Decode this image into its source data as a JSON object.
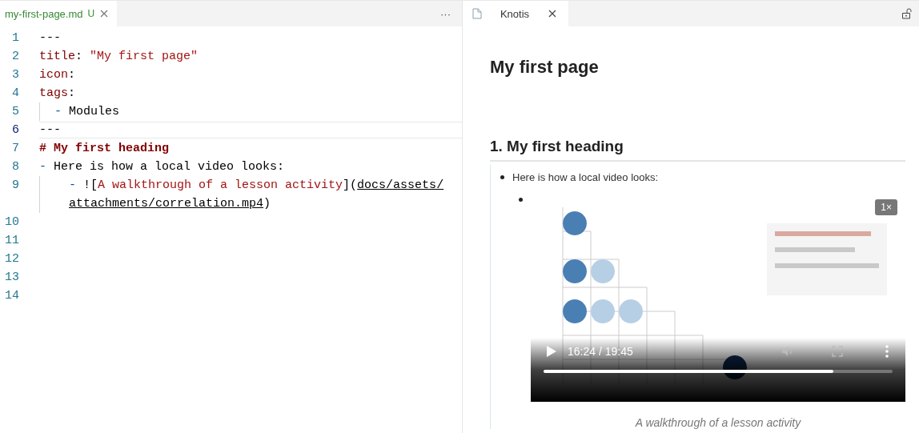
{
  "editor": {
    "tab": {
      "filename": "my-first-page.md",
      "status": "U",
      "selected": true
    },
    "more": "···",
    "lines": [
      {
        "number": "1",
        "current": false,
        "guide": false,
        "segments": [
          {
            "kind": "punct",
            "text": "---"
          }
        ]
      },
      {
        "number": "2",
        "current": false,
        "guide": false,
        "segments": [
          {
            "kind": "key",
            "text": "title"
          },
          {
            "kind": "punct",
            "text": ": "
          },
          {
            "kind": "string",
            "text": "\"My first page\""
          }
        ]
      },
      {
        "number": "3",
        "current": false,
        "guide": false,
        "segments": [
          {
            "kind": "key",
            "text": "icon"
          },
          {
            "kind": "punct",
            "text": ":"
          }
        ]
      },
      {
        "number": "4",
        "current": false,
        "guide": false,
        "segments": [
          {
            "kind": "key",
            "text": "tags"
          },
          {
            "kind": "punct",
            "text": ":"
          }
        ]
      },
      {
        "number": "5",
        "current": false,
        "guide": true,
        "segments": [
          {
            "kind": "bullet",
            "text": "  - "
          },
          {
            "kind": "punct",
            "text": "Modules"
          }
        ]
      },
      {
        "number": "6",
        "current": true,
        "guide": false,
        "segments": [
          {
            "kind": "punct",
            "text": "---"
          }
        ]
      },
      {
        "number": "7",
        "current": false,
        "guide": false,
        "segments": [
          {
            "kind": "heading",
            "text": "# My first heading"
          }
        ]
      },
      {
        "number": "8",
        "current": false,
        "guide": false,
        "segments": [
          {
            "kind": "bullet",
            "text": "- "
          },
          {
            "kind": "punct",
            "text": "Here is how a local video looks:"
          }
        ]
      },
      {
        "number": "9",
        "current": false,
        "guide": true,
        "segments": [
          {
            "kind": "bullet",
            "text": "    - "
          },
          {
            "kind": "punct",
            "text": "!["
          },
          {
            "kind": "string",
            "text": "A walkthrough of a lesson activity"
          },
          {
            "kind": "punct",
            "text": "]("
          },
          {
            "kind": "url",
            "text": "docs/assets/"
          }
        ],
        "continuation": [
          {
            "kind": "url",
            "text": "attachments/correlation.mp4"
          },
          {
            "kind": "punct",
            "text": ")"
          }
        ]
      },
      {
        "number": "10",
        "current": false,
        "guide": false
      },
      {
        "number": "11",
        "current": false,
        "guide": false
      },
      {
        "number": "12",
        "current": false,
        "guide": false
      },
      {
        "number": "13",
        "current": false,
        "guide": false
      },
      {
        "number": "14",
        "current": false,
        "guide": false
      }
    ]
  },
  "preview": {
    "tab": {
      "title": "Knotis",
      "selected": true
    },
    "title": "My first page",
    "heading": "1. My first heading",
    "bullet": "Here is how a local video looks:",
    "video": {
      "kind": "picture",
      "speed": "1×",
      "time": "16:24 / 19:45",
      "level": 0.83
    },
    "caption": "A walkthrough of a lesson activity"
  }
}
